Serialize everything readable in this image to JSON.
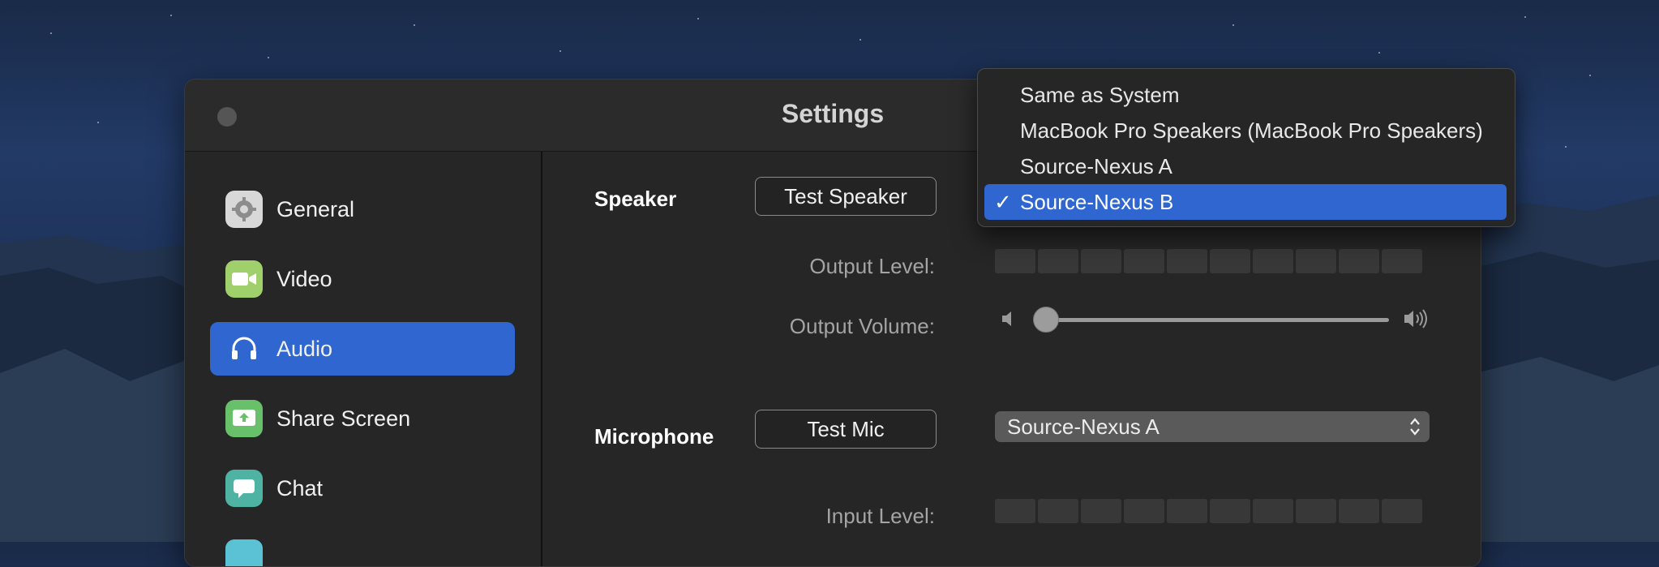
{
  "window": {
    "title": "Settings"
  },
  "sidebar": {
    "items": [
      {
        "label": "General",
        "icon": "gear-icon",
        "color": "#d8d8d8"
      },
      {
        "label": "Video",
        "icon": "video-camera-icon",
        "color": "#9fd06b"
      },
      {
        "label": "Audio",
        "icon": "headphones-icon",
        "color": "#2f66cf",
        "active": true
      },
      {
        "label": "Share Screen",
        "icon": "share-screen-icon",
        "color": "#69c06a"
      },
      {
        "label": "Chat",
        "icon": "chat-bubble-icon",
        "color": "#4fb3a4"
      }
    ]
  },
  "speaker": {
    "section_label": "Speaker",
    "test_button": "Test Speaker",
    "output_level_label": "Output Level:",
    "output_volume_label": "Output Volume:",
    "output_volume_fraction": 0.0
  },
  "microphone": {
    "section_label": "Microphone",
    "test_button": "Test Mic",
    "device_selected": "Source-Nexus A",
    "input_level_label": "Input Level:"
  },
  "speaker_dropdown": {
    "options": [
      "Same as System",
      "MacBook Pro Speakers (MacBook Pro Speakers)",
      "Source-Nexus A",
      "Source-Nexus B"
    ],
    "selected": "Source-Nexus B",
    "check_glyph": "✓"
  },
  "colors": {
    "accent": "#2f66cf"
  }
}
